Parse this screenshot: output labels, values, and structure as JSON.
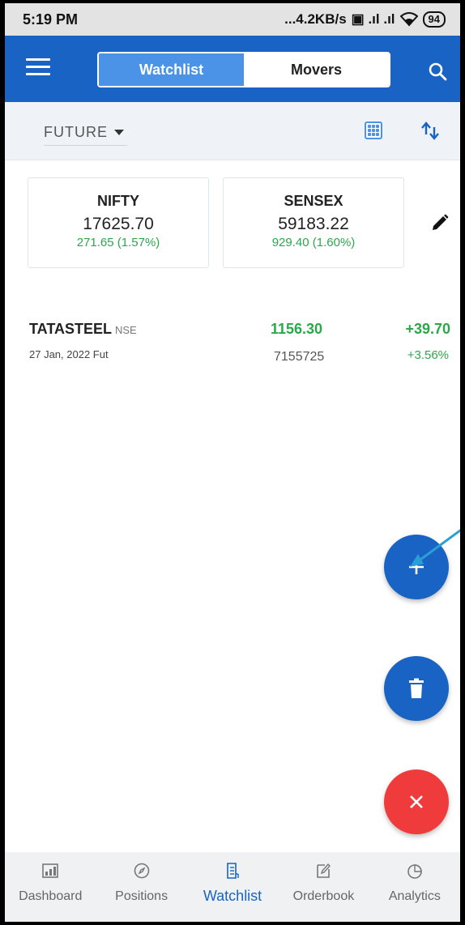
{
  "status_bar": {
    "time": "5:19 PM",
    "network_speed": "...4.2KB/s",
    "network_icons": "▣ .ıl .ıl",
    "battery": "94"
  },
  "header": {
    "tabs": [
      {
        "label": "Watchlist",
        "active": true
      },
      {
        "label": "Movers",
        "active": false
      }
    ]
  },
  "filter": {
    "selected": "FUTURE"
  },
  "indices": [
    {
      "name": "NIFTY",
      "price": "17625.70",
      "change": "271.65 (1.57%)"
    },
    {
      "name": "SENSEX",
      "price": "59183.22",
      "change": "929.40 (1.60%)"
    }
  ],
  "watchlist": [
    {
      "symbol": "TATASTEEL",
      "exchange": "NSE",
      "expiry": "27 Jan, 2022 Fut",
      "ltp": "1156.30",
      "volume": "7155725",
      "change": "+39.70",
      "change_pct": "+3.56%"
    }
  ],
  "bottom_nav": [
    {
      "label": "Dashboard",
      "icon": "dashboard-icon",
      "active": false
    },
    {
      "label": "Positions",
      "icon": "compass-icon",
      "active": false
    },
    {
      "label": "Watchlist",
      "icon": "watchlist-icon",
      "active": true
    },
    {
      "label": "Orderbook",
      "icon": "orderbook-icon",
      "active": false
    },
    {
      "label": "Analytics",
      "icon": "pie-chart-icon",
      "active": false
    }
  ],
  "colors": {
    "primary": "#1863c4",
    "positive": "#2aa84a",
    "danger": "#ef3b3b",
    "annotation_arrow": "#2a9fd6"
  }
}
